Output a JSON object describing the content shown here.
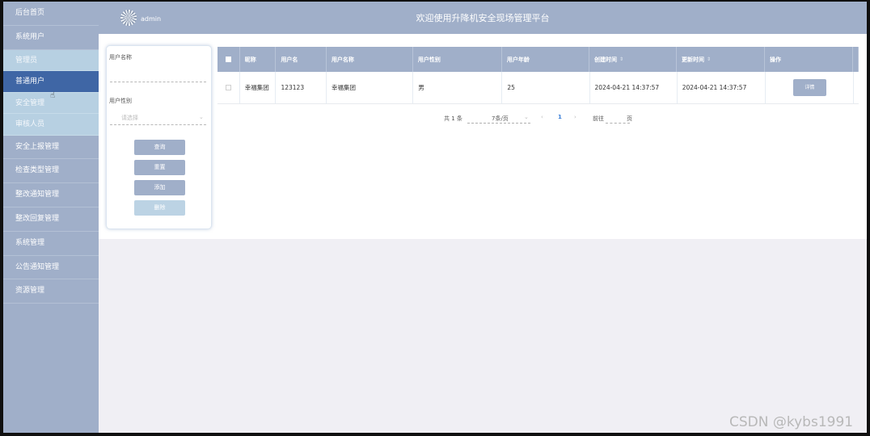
{
  "header": {
    "user": "admin",
    "title": "欢迎使用升降机安全现场管理平台"
  },
  "sidebar": {
    "items": [
      {
        "label": "后台首页"
      },
      {
        "label": "系统用户"
      },
      {
        "label": "管理员"
      },
      {
        "label": "普通用户"
      },
      {
        "label": "安全管理"
      },
      {
        "label": "审核人员"
      },
      {
        "label": "安全上报管理"
      },
      {
        "label": "检查类型管理"
      },
      {
        "label": "整改通知管理"
      },
      {
        "label": "整改回复管理"
      },
      {
        "label": "系统管理"
      },
      {
        "label": "公告通知管理"
      },
      {
        "label": "资源管理"
      }
    ]
  },
  "search": {
    "username_label": "用户名称",
    "gender_label": "用户性别",
    "gender_placeholder": "请选择",
    "query_btn": "查询",
    "reset_btn": "重置",
    "add_btn": "添加",
    "delete_btn": "删除"
  },
  "table": {
    "headers": [
      "昵称",
      "用户名",
      "用户名称",
      "用户性别",
      "用户年龄",
      "创建时间",
      "更新时间",
      "操作"
    ],
    "rows": [
      {
        "nickname": "幸福集团",
        "username": "123123",
        "name": "幸福集团",
        "gender": "男",
        "age": "25",
        "created": "2024-04-21 14:37:57",
        "updated": "2024-04-21 14:37:57",
        "action": "详情"
      }
    ]
  },
  "pagination": {
    "total": "共 1 条",
    "page_size": "7条/页",
    "current": "1",
    "goto": "前往",
    "page_unit": "页"
  },
  "watermark": "CSDN @kybs1991",
  "colors": {
    "primary": "#a0afc9",
    "active_menu": "#3f66a5",
    "sub_menu": "#b7d0e2",
    "page_bg": "#f0eff4"
  }
}
